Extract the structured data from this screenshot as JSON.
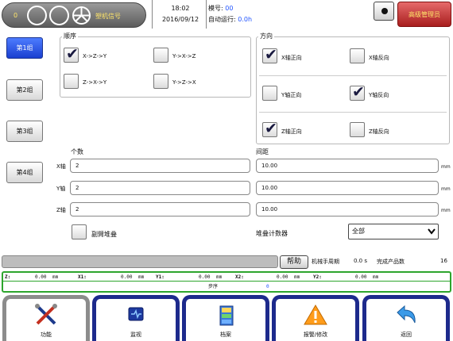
{
  "topbar": {
    "counter": "0",
    "plc_label": "塑机信号",
    "time": "18:02",
    "date": "2016/09/12",
    "mold_label": "模号: ",
    "mold_value": "00",
    "autorun_label": "自动运行: ",
    "autorun_value": "0.0h",
    "user_role": "高级管理员"
  },
  "groups": [
    "第1组",
    "第2组",
    "第3组",
    "第4组"
  ],
  "order": {
    "title": "顺序",
    "options": [
      {
        "label": "X->Z->Y",
        "checked": true
      },
      {
        "label": "Y->X->Z",
        "checked": false
      },
      {
        "label": "Z->X->Y",
        "checked": false
      },
      {
        "label": "Y->Z->X",
        "checked": false
      }
    ]
  },
  "direction": {
    "title": "方向",
    "options": [
      {
        "label": "X轴正向",
        "checked": true
      },
      {
        "label": "X轴反向",
        "checked": false
      },
      {
        "label": "Y轴正向",
        "checked": false
      },
      {
        "label": "Y轴反向",
        "checked": true
      },
      {
        "label": "Z轴正向",
        "checked": true
      },
      {
        "label": "Z轴反向",
        "checked": false
      }
    ]
  },
  "count": {
    "title": "个数",
    "axes": [
      {
        "label": "X轴",
        "value": "2"
      },
      {
        "label": "Y轴",
        "value": "2"
      },
      {
        "label": "Z轴",
        "value": "2"
      }
    ]
  },
  "spacing": {
    "title": "间距",
    "values": [
      "10.00",
      "10.00",
      "10.00"
    ],
    "unit": "mm"
  },
  "sub_stack": {
    "label": "副臂堆叠",
    "checked": false
  },
  "stack_counter": {
    "label": "堆叠计数器",
    "selected": "全部"
  },
  "status": {
    "help": "帮助",
    "cycle_label": "机械手周期",
    "cycle_value": "0.0 s",
    "products_label": "完成产品数",
    "products_value": "16"
  },
  "coords": {
    "cells": [
      {
        "label": "Z:",
        "value": "0.00",
        "unit": "mm"
      },
      {
        "label": "X1:",
        "value": "0.00",
        "unit": "mm"
      },
      {
        "label": "Y1:",
        "value": "0.00",
        "unit": "mm"
      },
      {
        "label": "X2:",
        "value": "0.00",
        "unit": "mm"
      },
      {
        "label": "Y2:",
        "value": "0.00",
        "unit": "mm"
      }
    ],
    "step_label": "步序",
    "step_value": "0"
  },
  "nav": [
    {
      "label": "功能",
      "icon": "tools-icon",
      "color": "#8c8c8c"
    },
    {
      "label": "监视",
      "icon": "monitor-icon",
      "color": "#1d2a8c"
    },
    {
      "label": "档案",
      "icon": "file-cabinet-icon",
      "color": "#1d2a8c"
    },
    {
      "label": "报警/修改",
      "icon": "warning-icon",
      "color": "#1d2a8c"
    },
    {
      "label": "返回",
      "icon": "return-arrow-icon",
      "color": "#1d2a8c"
    }
  ],
  "colors": {
    "accent_blue": "#2255ff",
    "active_group": "#1a3fd0",
    "coord_border": "#2da52d",
    "admin_red": "#c03030"
  }
}
